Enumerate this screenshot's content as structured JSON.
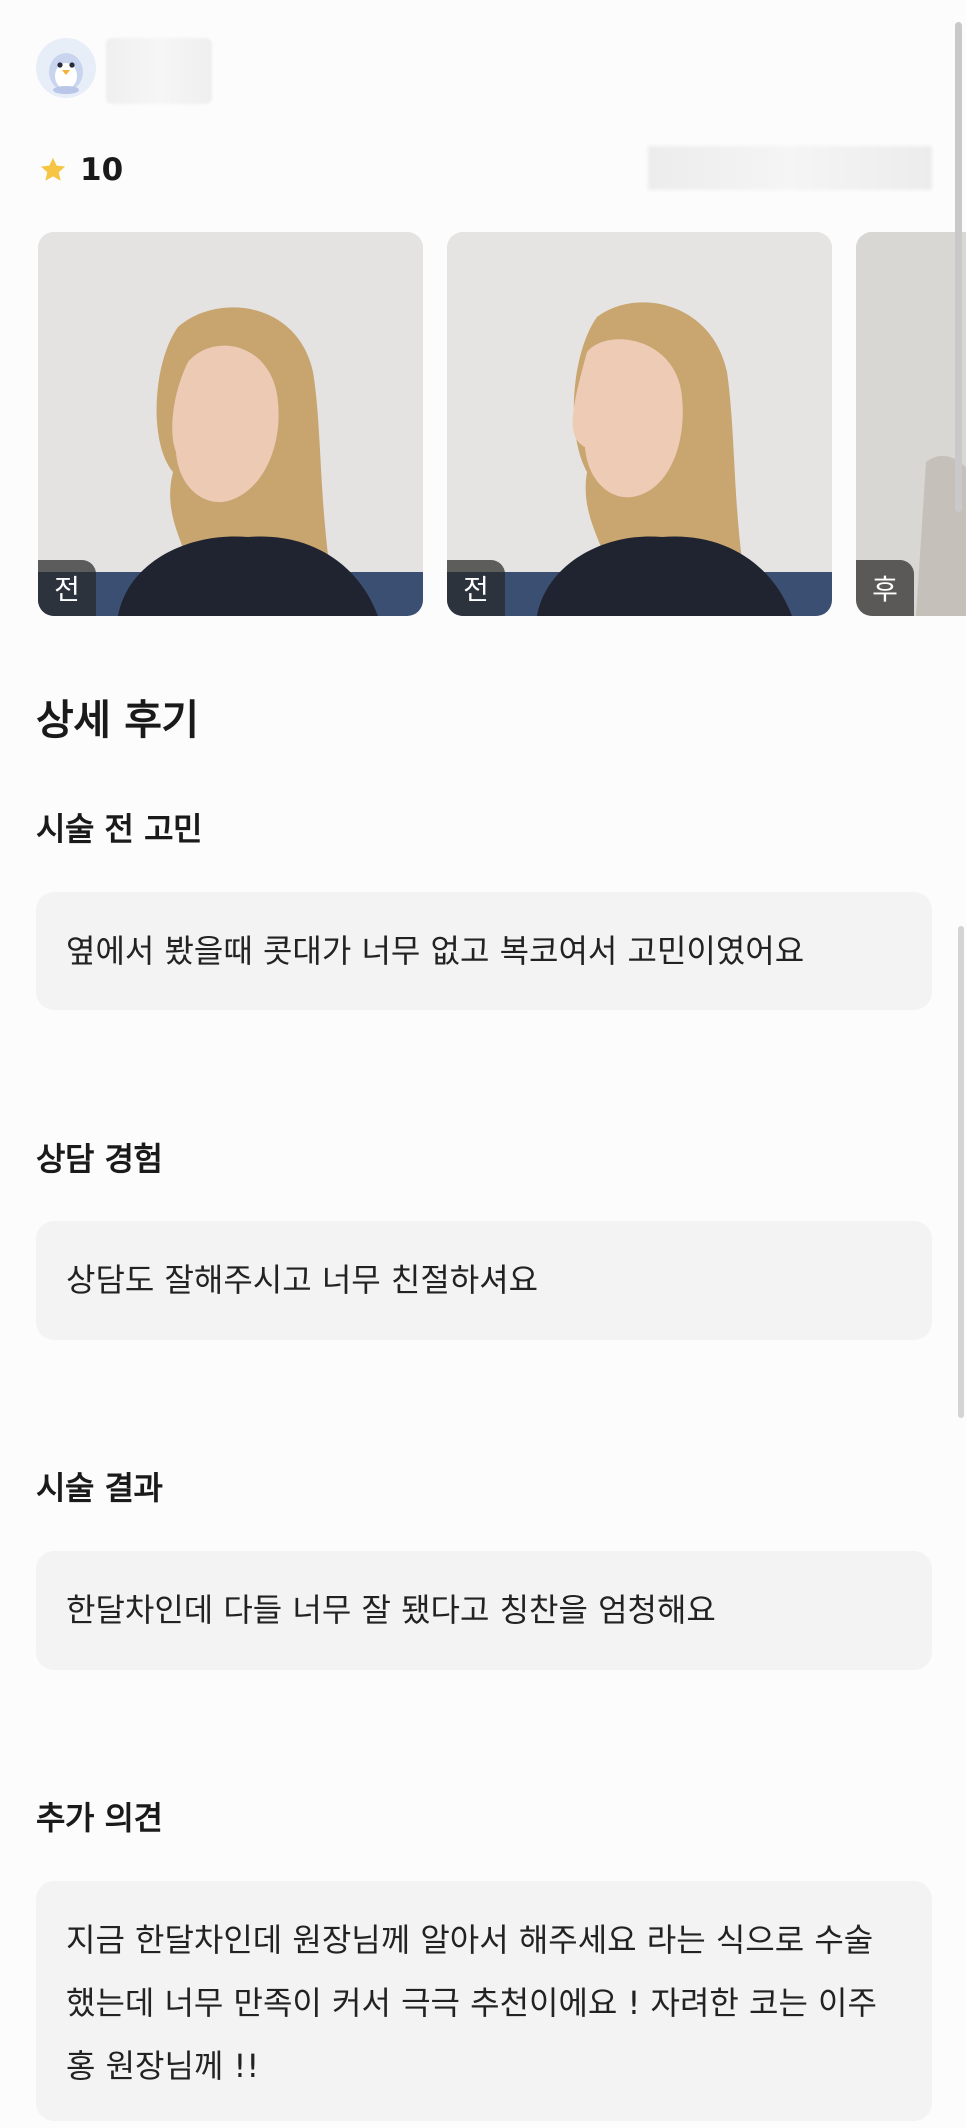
{
  "review": {
    "rating": "10",
    "photos": [
      {
        "badge": "전"
      },
      {
        "badge": "전"
      },
      {
        "badge": "후"
      }
    ],
    "section_title": "상세 후기",
    "questions": [
      {
        "label": "시술 전 고민",
        "answer": "옆에서 봤을때 콧대가 너무 없고 복코여서 고민이였어요"
      },
      {
        "label": "상담 경험",
        "answer": "상담도 잘해주시고 너무 친절하셔요"
      },
      {
        "label": "시술 결과",
        "answer": "한달차인데 다들 너무 잘 됐다고 칭찬을 엄청해요"
      },
      {
        "label": "추가 의견",
        "answer": "지금 한달차인데 원장님께 알아서 해주세요 라는 식으로 수술 했는데 너무 만족이 커서 극극 추천이에요 ! 자려한 코는 이주홍 원장님께 !!"
      }
    ]
  },
  "colors": {
    "star": "#f7c544",
    "answer_bg": "#f3f3f3",
    "badge_bg": "#333333"
  },
  "icons": {
    "avatar": "penguin-avatar-icon",
    "rating": "star-icon"
  }
}
